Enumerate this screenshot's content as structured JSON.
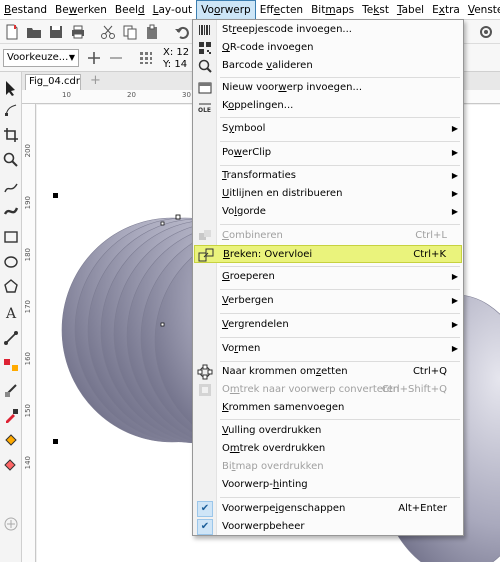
{
  "menubar": {
    "items": [
      {
        "pre": "",
        "ul": "B",
        "post": "estand"
      },
      {
        "pre": "Be",
        "ul": "w",
        "post": "erken"
      },
      {
        "pre": "Beel",
        "ul": "d",
        "post": ""
      },
      {
        "pre": "",
        "ul": "L",
        "post": "ay-out"
      },
      {
        "pre": "Vo",
        "ul": "o",
        "post": "rwerp"
      },
      {
        "pre": "Eff",
        "ul": "e",
        "post": "cten"
      },
      {
        "pre": "Bit",
        "ul": "m",
        "post": "aps"
      },
      {
        "pre": "Te",
        "ul": "k",
        "post": "st"
      },
      {
        "pre": "",
        "ul": "T",
        "post": "abel"
      },
      {
        "pre": "E",
        "ul": "x",
        "post": "tra"
      },
      {
        "pre": "",
        "ul": "V",
        "post": "enster"
      }
    ]
  },
  "toolbar": {
    "preset_value": "Voorkeuze...",
    "x_label": "X:",
    "x_value": "12",
    "y_label": "Y:",
    "y_value": "14"
  },
  "document": {
    "tab_name": "Fig_04.cdr",
    "add_tab": "+"
  },
  "rulers": {
    "h_ticks": [
      "10",
      "20",
      "30"
    ],
    "v_ticks": [
      "200",
      "190",
      "180",
      "170",
      "160",
      "150",
      "140"
    ]
  },
  "menu": {
    "items": [
      {
        "pre": "St",
        "ul": "r",
        "post": "eepjescode invoegen...",
        "shortcut": "",
        "submenu": false,
        "disabled": false,
        "icon": "barcode-icon"
      },
      {
        "pre": "",
        "ul": "Q",
        "post": "R-code invoegen",
        "shortcut": "",
        "submenu": false,
        "disabled": false,
        "icon": "qr-code-icon"
      },
      {
        "pre": "Barcode ",
        "ul": "v",
        "post": "alideren",
        "shortcut": "",
        "submenu": false,
        "disabled": false,
        "icon": "barcode-validate-icon"
      },
      {
        "pre": "Nieuw voor",
        "ul": "w",
        "post": "erp invoegen...",
        "shortcut": "",
        "submenu": false,
        "disabled": false,
        "icon": "new-object-icon"
      },
      {
        "pre": "K",
        "ul": "o",
        "post": "ppelingen...",
        "shortcut": "",
        "submenu": false,
        "disabled": false,
        "icon": "ole-links-icon"
      },
      {
        "pre": "S",
        "ul": "y",
        "post": "mbool",
        "shortcut": "",
        "submenu": true,
        "disabled": false,
        "icon": ""
      },
      {
        "pre": "Po",
        "ul": "w",
        "post": "erClip",
        "shortcut": "",
        "submenu": true,
        "disabled": false,
        "icon": ""
      },
      {
        "pre": "",
        "ul": "T",
        "post": "ransformaties",
        "shortcut": "",
        "submenu": true,
        "disabled": false,
        "icon": ""
      },
      {
        "pre": "",
        "ul": "U",
        "post": "itlijnen en distribueren",
        "shortcut": "",
        "submenu": true,
        "disabled": false,
        "icon": ""
      },
      {
        "pre": "Vo",
        "ul": "l",
        "post": "gorde",
        "shortcut": "",
        "submenu": true,
        "disabled": false,
        "icon": ""
      },
      {
        "pre": "",
        "ul": "C",
        "post": "ombineren",
        "shortcut": "Ctrl+L",
        "submenu": false,
        "disabled": true,
        "icon": "combine-icon"
      },
      {
        "pre": "",
        "ul": "B",
        "post": "reken: Overvloei",
        "shortcut": "Ctrl+K",
        "submenu": false,
        "disabled": false,
        "icon": "break-apart-icon"
      },
      {
        "pre": "",
        "ul": "G",
        "post": "roeperen",
        "shortcut": "",
        "submenu": true,
        "disabled": false,
        "icon": ""
      },
      {
        "pre": "",
        "ul": "V",
        "post": "erbergen",
        "shortcut": "",
        "submenu": true,
        "disabled": false,
        "icon": ""
      },
      {
        "pre": "",
        "ul": "V",
        "post": "ergrendelen",
        "shortcut": "",
        "submenu": true,
        "disabled": false,
        "icon": ""
      },
      {
        "pre": "Vo",
        "ul": "r",
        "post": "men",
        "shortcut": "",
        "submenu": true,
        "disabled": false,
        "icon": ""
      },
      {
        "pre": "Naar krommen om",
        "ul": "z",
        "post": "etten",
        "shortcut": "Ctrl+Q",
        "submenu": false,
        "disabled": false,
        "icon": "convert-to-curves-icon"
      },
      {
        "pre": "O",
        "ul": "m",
        "post": "trek naar voorwerp converteren",
        "shortcut": "Ctrl+Shift+Q",
        "submenu": false,
        "disabled": true,
        "icon": "outline-to-object-icon"
      },
      {
        "pre": "",
        "ul": "K",
        "post": "rommen samenvoegen",
        "shortcut": "",
        "submenu": false,
        "disabled": false,
        "icon": ""
      },
      {
        "pre": "",
        "ul": "V",
        "post": "ulling overdrukken",
        "shortcut": "",
        "submenu": false,
        "disabled": false,
        "icon": ""
      },
      {
        "pre": "O",
        "ul": "m",
        "post": "trek overdrukken",
        "shortcut": "",
        "submenu": false,
        "disabled": false,
        "icon": ""
      },
      {
        "pre": "Bi",
        "ul": "t",
        "post": "map overdrukken",
        "shortcut": "",
        "submenu": false,
        "disabled": true,
        "icon": ""
      },
      {
        "pre": "Voorwerp-",
        "ul": "h",
        "post": "inting",
        "shortcut": "",
        "submenu": false,
        "disabled": false,
        "icon": ""
      },
      {
        "pre": "Voorwerpe",
        "ul": "i",
        "post": "genschappen",
        "shortcut": "Alt+Enter",
        "submenu": false,
        "disabled": false,
        "icon": "check-icon",
        "checked": true
      },
      {
        "pre": "Voorwerpbeheer",
        "ul": "",
        "post": "",
        "shortcut": "",
        "submenu": false,
        "disabled": false,
        "icon": "check-icon",
        "checked": true
      }
    ],
    "submenu_arrow": "▶",
    "check_mark": "✔"
  },
  "colors": {
    "highlight": "#eaf37c",
    "menu_active": "#cde6f7",
    "shape_dark": "#6c6c84",
    "shape_light": "#d6d6e0"
  }
}
